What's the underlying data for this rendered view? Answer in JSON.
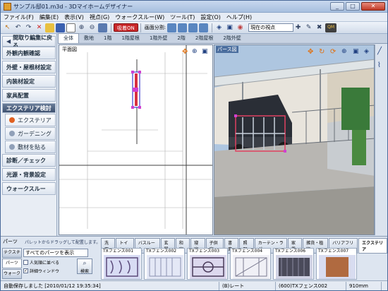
{
  "window": {
    "title": "サンプル邸01.m3d - 3Dマイホームデザイナー"
  },
  "menu": [
    "ファイル(F)",
    "編集(E)",
    "表示(V)",
    "視点(G)",
    "ウォークスルー(W)",
    "ツール(T)",
    "設定(O)",
    "ヘルプ(H)"
  ],
  "toolbar": {
    "highlight_label": "吸着ON",
    "screen_split_label": "画面分割:",
    "viewpoint_select": "現在の視点"
  },
  "left_panel": {
    "back_button": "間取り編集に戻る",
    "items": [
      "外観内観確認",
      "外壁・屋根材設定",
      "内装材設定",
      "家具配置"
    ],
    "exterior_header": "エクステリア検討",
    "sub_items": [
      "エクステリア",
      "ガーデニング",
      "敷材を貼る"
    ],
    "items2": [
      "診断／チェック",
      "光源・背景設定",
      "ウォークスルー"
    ]
  },
  "view_tabs": [
    "全体",
    "敷地",
    "1階",
    "1階屋根",
    "1階外壁",
    "2階",
    "2階屋根",
    "2階外壁"
  ],
  "views": {
    "plan_label": "平面図",
    "persp_label": "パース図"
  },
  "parts": {
    "title": "パーツ",
    "hint": "パレットからドラッグして配置します。",
    "category_tabs": [
      "洗面",
      "トイレ",
      "バスルーム",
      "玄関",
      "和室",
      "寝室",
      "子供室",
      "書斎",
      "照明",
      "カーテン・ラグ",
      "家電",
      "雑貨・植物",
      "バリアフリー",
      "エクステリア"
    ],
    "side_buttons": [
      "テクスチャ",
      "パーツ",
      "ウォーク"
    ],
    "filter_select": "すべてのパーツを表示",
    "checkbox_popular": "人気順に並べる",
    "checkbox_detail": "詳細ウィンドウ",
    "search_label": "検索",
    "thumbs": [
      "TXフェンス001",
      "TXフェンス002",
      "TXフェンス003",
      "TXフェンス004",
      "TXフェンス006",
      "TXフェンス007"
    ]
  },
  "status": {
    "message": "自動保存しました [2010/01/12 19:35:34]",
    "layer": "(B)レート",
    "part": "(600)TXフェンス002",
    "size": "910mm"
  }
}
